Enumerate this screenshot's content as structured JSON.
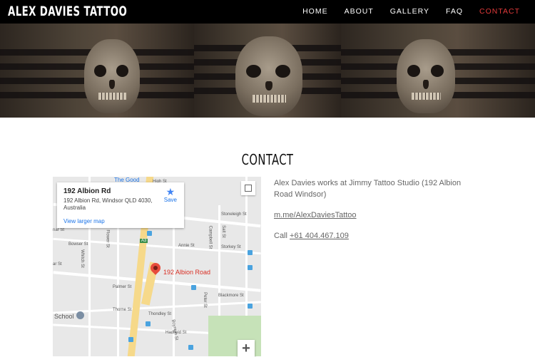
{
  "header": {
    "logo": "ALEX DAVIES TATTOO",
    "nav": [
      "HOME",
      "ABOUT",
      "GALLERY",
      "FAQ",
      "CONTACT"
    ],
    "active_nav": "CONTACT",
    "active_color": "#e23a3a"
  },
  "page": {
    "heading": "CONTACT"
  },
  "map": {
    "card_title": "192 Albion Rd",
    "card_address": "192 Albion Rd, Windsor QLD 4030, Australia",
    "view_larger": "View larger map",
    "save_label": "Save",
    "marker_label": "192 Albion Road",
    "school_label": "School",
    "top_label": "The Good",
    "zoom_in": "+",
    "streets": [
      "High St",
      "Stoneleigh St",
      "Bowser St",
      "Annie St",
      "Storkey St",
      "Palmer St",
      "Thorne St",
      "Thondley St",
      "Blackmore St",
      "Hadfield St",
      "Flower St",
      "Campbell St",
      "Salt St",
      "Peter St",
      "Boynton St",
      "Whitch St",
      "A3",
      "nar St",
      "ar St"
    ]
  },
  "contact": {
    "intro": "Alex Davies works at Jimmy Tattoo Studio (192 Albion Road Windsor)",
    "messenger_link": "m.me/AlexDaviesTattoo",
    "call_prefix": "Call ",
    "phone": "+61 404.467.109"
  }
}
